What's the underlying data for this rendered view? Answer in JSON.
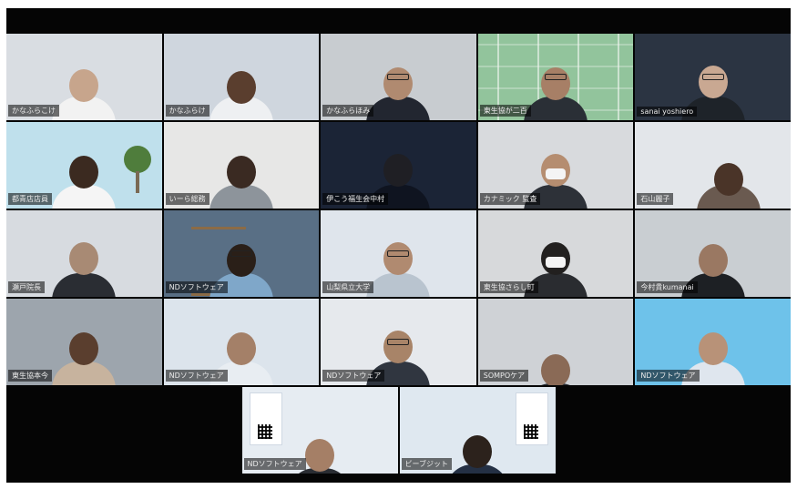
{
  "row1": [
    {
      "label": "かなふらこけ",
      "bg": "#d9dde2"
    },
    {
      "label": "かなふらけ",
      "bg": "#cfd6de"
    },
    {
      "label": "かなふらほみ",
      "bg": "#c8ccd0"
    },
    {
      "label": "東生協が二百",
      "bg": "#e9efe7"
    },
    {
      "label": "sanai yoshiero",
      "bg": "#2b3442"
    }
  ],
  "row2": [
    {
      "label": "都青店店員",
      "bg": "#bfe0ec"
    },
    {
      "label": "いーら総務",
      "bg": "#e7e7e6"
    },
    {
      "label": "伊こう福生会中村",
      "bg": "#1b2436"
    },
    {
      "label": "カナミック 監査",
      "bg": "#d8dadd"
    },
    {
      "label": "石山麗子",
      "bg": "#e3e6ea"
    }
  ],
  "row3": [
    {
      "label": "瀬戸院長",
      "bg": "#d7dbe0"
    },
    {
      "label": "NDソフトウェア",
      "bg": "#596f85"
    },
    {
      "label": "山梨県立大学",
      "bg": "#dfe5ec"
    },
    {
      "label": "東生協さらし町",
      "bg": "#d7d9db"
    },
    {
      "label": "今村貴kumanai",
      "bg": "#c9ced2"
    }
  ],
  "row4": [
    {
      "label": "東生協本今",
      "bg": "#9da5ad"
    },
    {
      "label": "NDソフトウェア",
      "bg": "#dce4ec"
    },
    {
      "label": "NDソフトウェア",
      "bg": "#e6e9ed"
    },
    {
      "label": "SOMPOケア",
      "bg": "#cfd2d6"
    },
    {
      "label": "NDソフトウェア",
      "bg": "#6ec2ea"
    }
  ],
  "row5": [
    {
      "label": "NDソフトウェア",
      "bg": "#e6ecf2"
    },
    {
      "label": "ビーブジット",
      "bg": "#dfe8f0"
    }
  ]
}
